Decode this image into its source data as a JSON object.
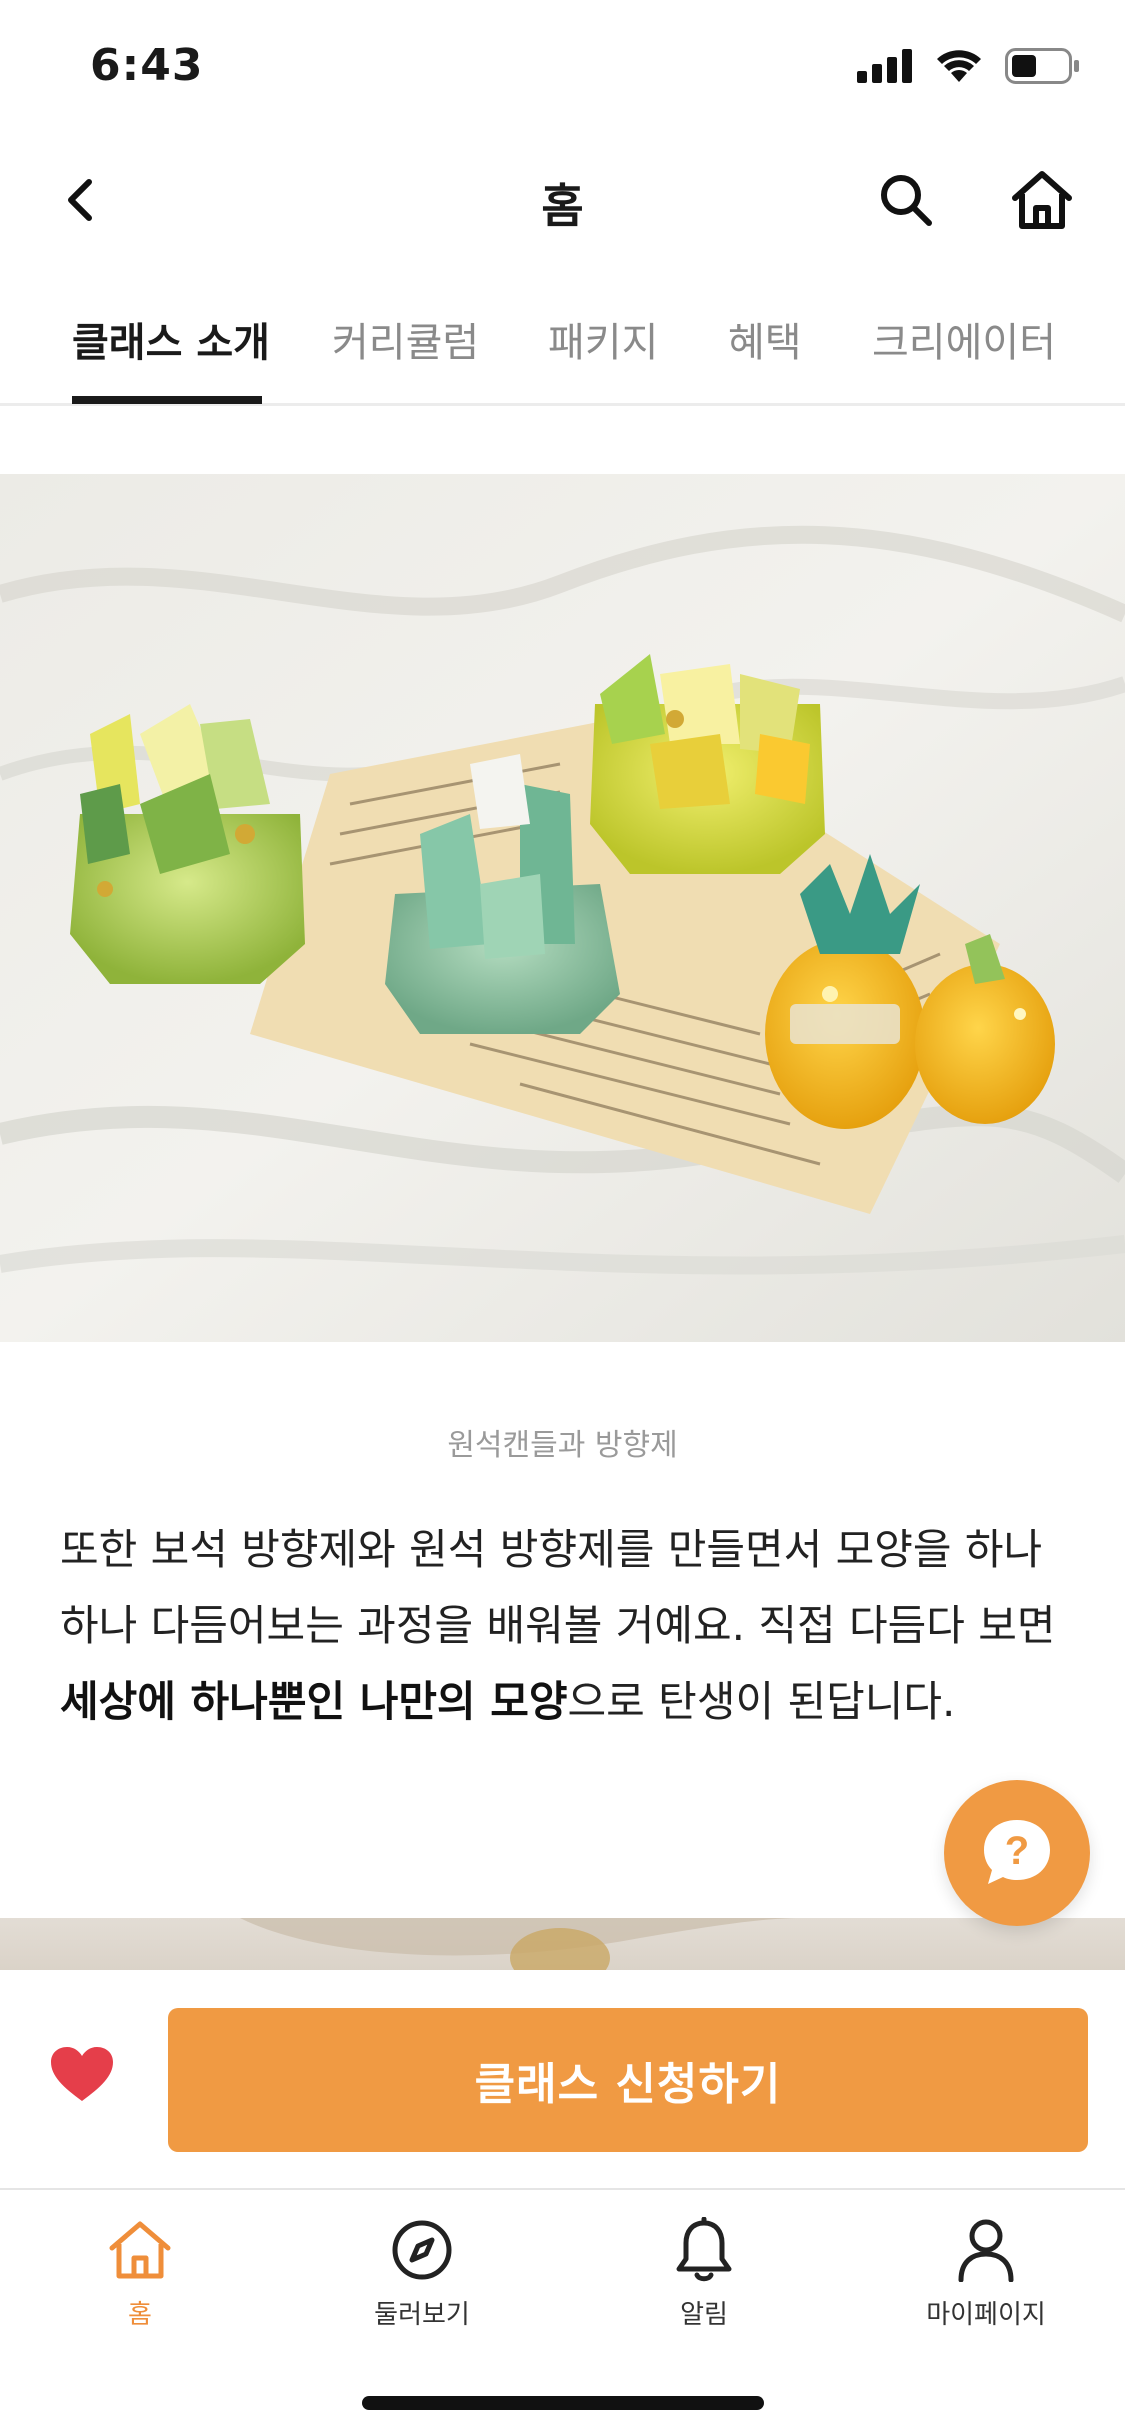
{
  "status": {
    "time": "6:43"
  },
  "nav": {
    "title": "홈",
    "icons": {
      "back": "chevron-left-icon",
      "search": "search-icon",
      "home": "home-icon"
    }
  },
  "tabs": [
    {
      "label": "클래스 소개",
      "active": true
    },
    {
      "label": "커리큘럼",
      "active": false
    },
    {
      "label": "패키지",
      "active": false
    },
    {
      "label": "혜택",
      "active": false
    },
    {
      "label": "크리에이터",
      "active": false
    }
  ],
  "content": {
    "caption": "원석캔들과 방향제",
    "body": {
      "part1": "또한 보석 방향제와 원석 방향제를 만들면서 모양을 하나하나 다듬어보는 과정을 배워볼 거예요. 직접 다듬다 보면 ",
      "bold": "세상에 하나뿐인 나만의 모양",
      "part2": "으로 탄생이 된답니다."
    }
  },
  "fab": {
    "icon": "help-chat-icon"
  },
  "cta": {
    "apply_label": "클래스 신청하기",
    "like_icon": "heart-icon"
  },
  "bottom_nav": [
    {
      "label": "홈",
      "icon": "home-icon",
      "active": true
    },
    {
      "label": "둘러보기",
      "icon": "compass-icon",
      "active": false
    },
    {
      "label": "알림",
      "icon": "bell-icon",
      "active": false
    },
    {
      "label": "마이페이지",
      "icon": "person-icon",
      "active": false
    }
  ],
  "colors": {
    "accent": "#f09a43",
    "heart": "#e53e4a",
    "text": "#1a1a1a",
    "muted": "#8a8a8a"
  }
}
